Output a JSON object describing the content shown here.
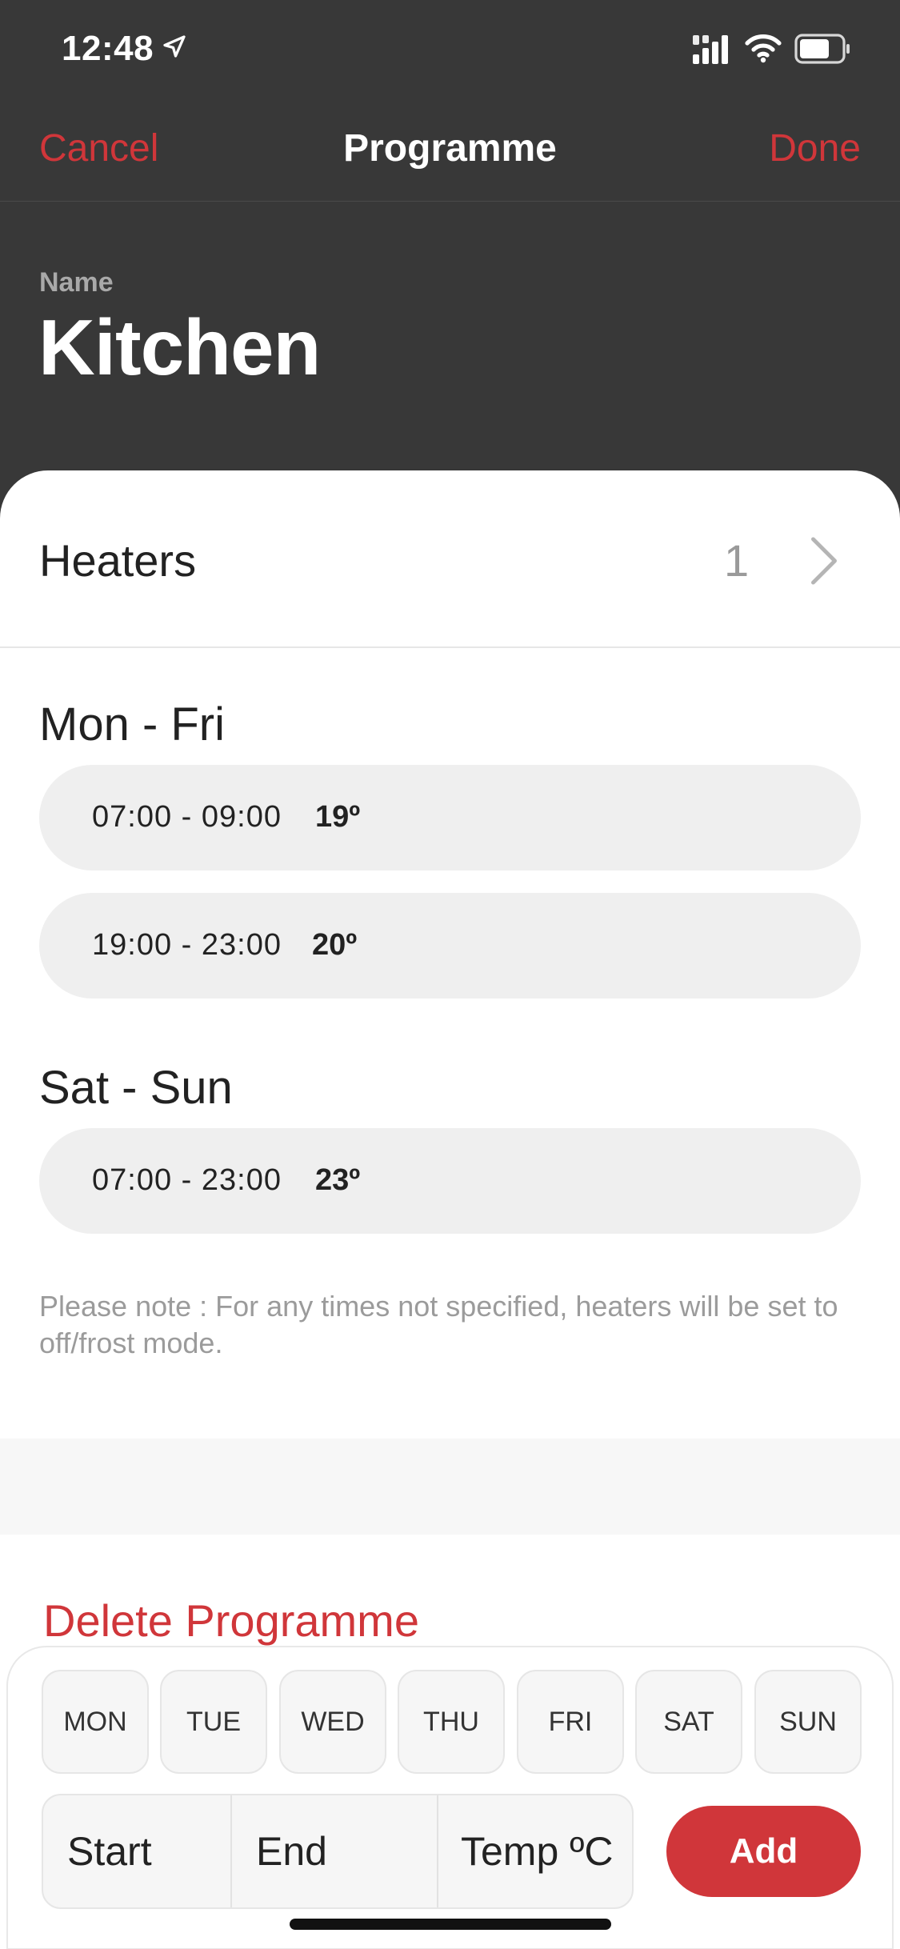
{
  "status_bar": {
    "time": "12:48"
  },
  "nav": {
    "cancel": "Cancel",
    "title": "Programme",
    "done": "Done"
  },
  "name": {
    "label": "Name",
    "value": "Kitchen"
  },
  "heaters": {
    "label": "Heaters",
    "count": "1"
  },
  "groups": [
    {
      "title": "Mon - Fri",
      "slots": [
        {
          "time": "07:00 - 09:00",
          "temp": "19º"
        },
        {
          "time": "19:00 - 23:00",
          "temp": "20º"
        }
      ]
    },
    {
      "title": "Sat - Sun",
      "slots": [
        {
          "time": "07:00 - 23:00",
          "temp": "23º"
        }
      ]
    }
  ],
  "note": "Please note : For any times not specified, heaters will be set to off/frost mode.",
  "delete_label": "Delete Programme",
  "editor": {
    "days": [
      "MON",
      "TUE",
      "WED",
      "THU",
      "FRI",
      "SAT",
      "SUN"
    ],
    "start": "Start",
    "end": "End",
    "temp": "Temp ºC",
    "add": "Add"
  },
  "colors": {
    "accent": "#d0363a",
    "header_bg": "#383838"
  }
}
